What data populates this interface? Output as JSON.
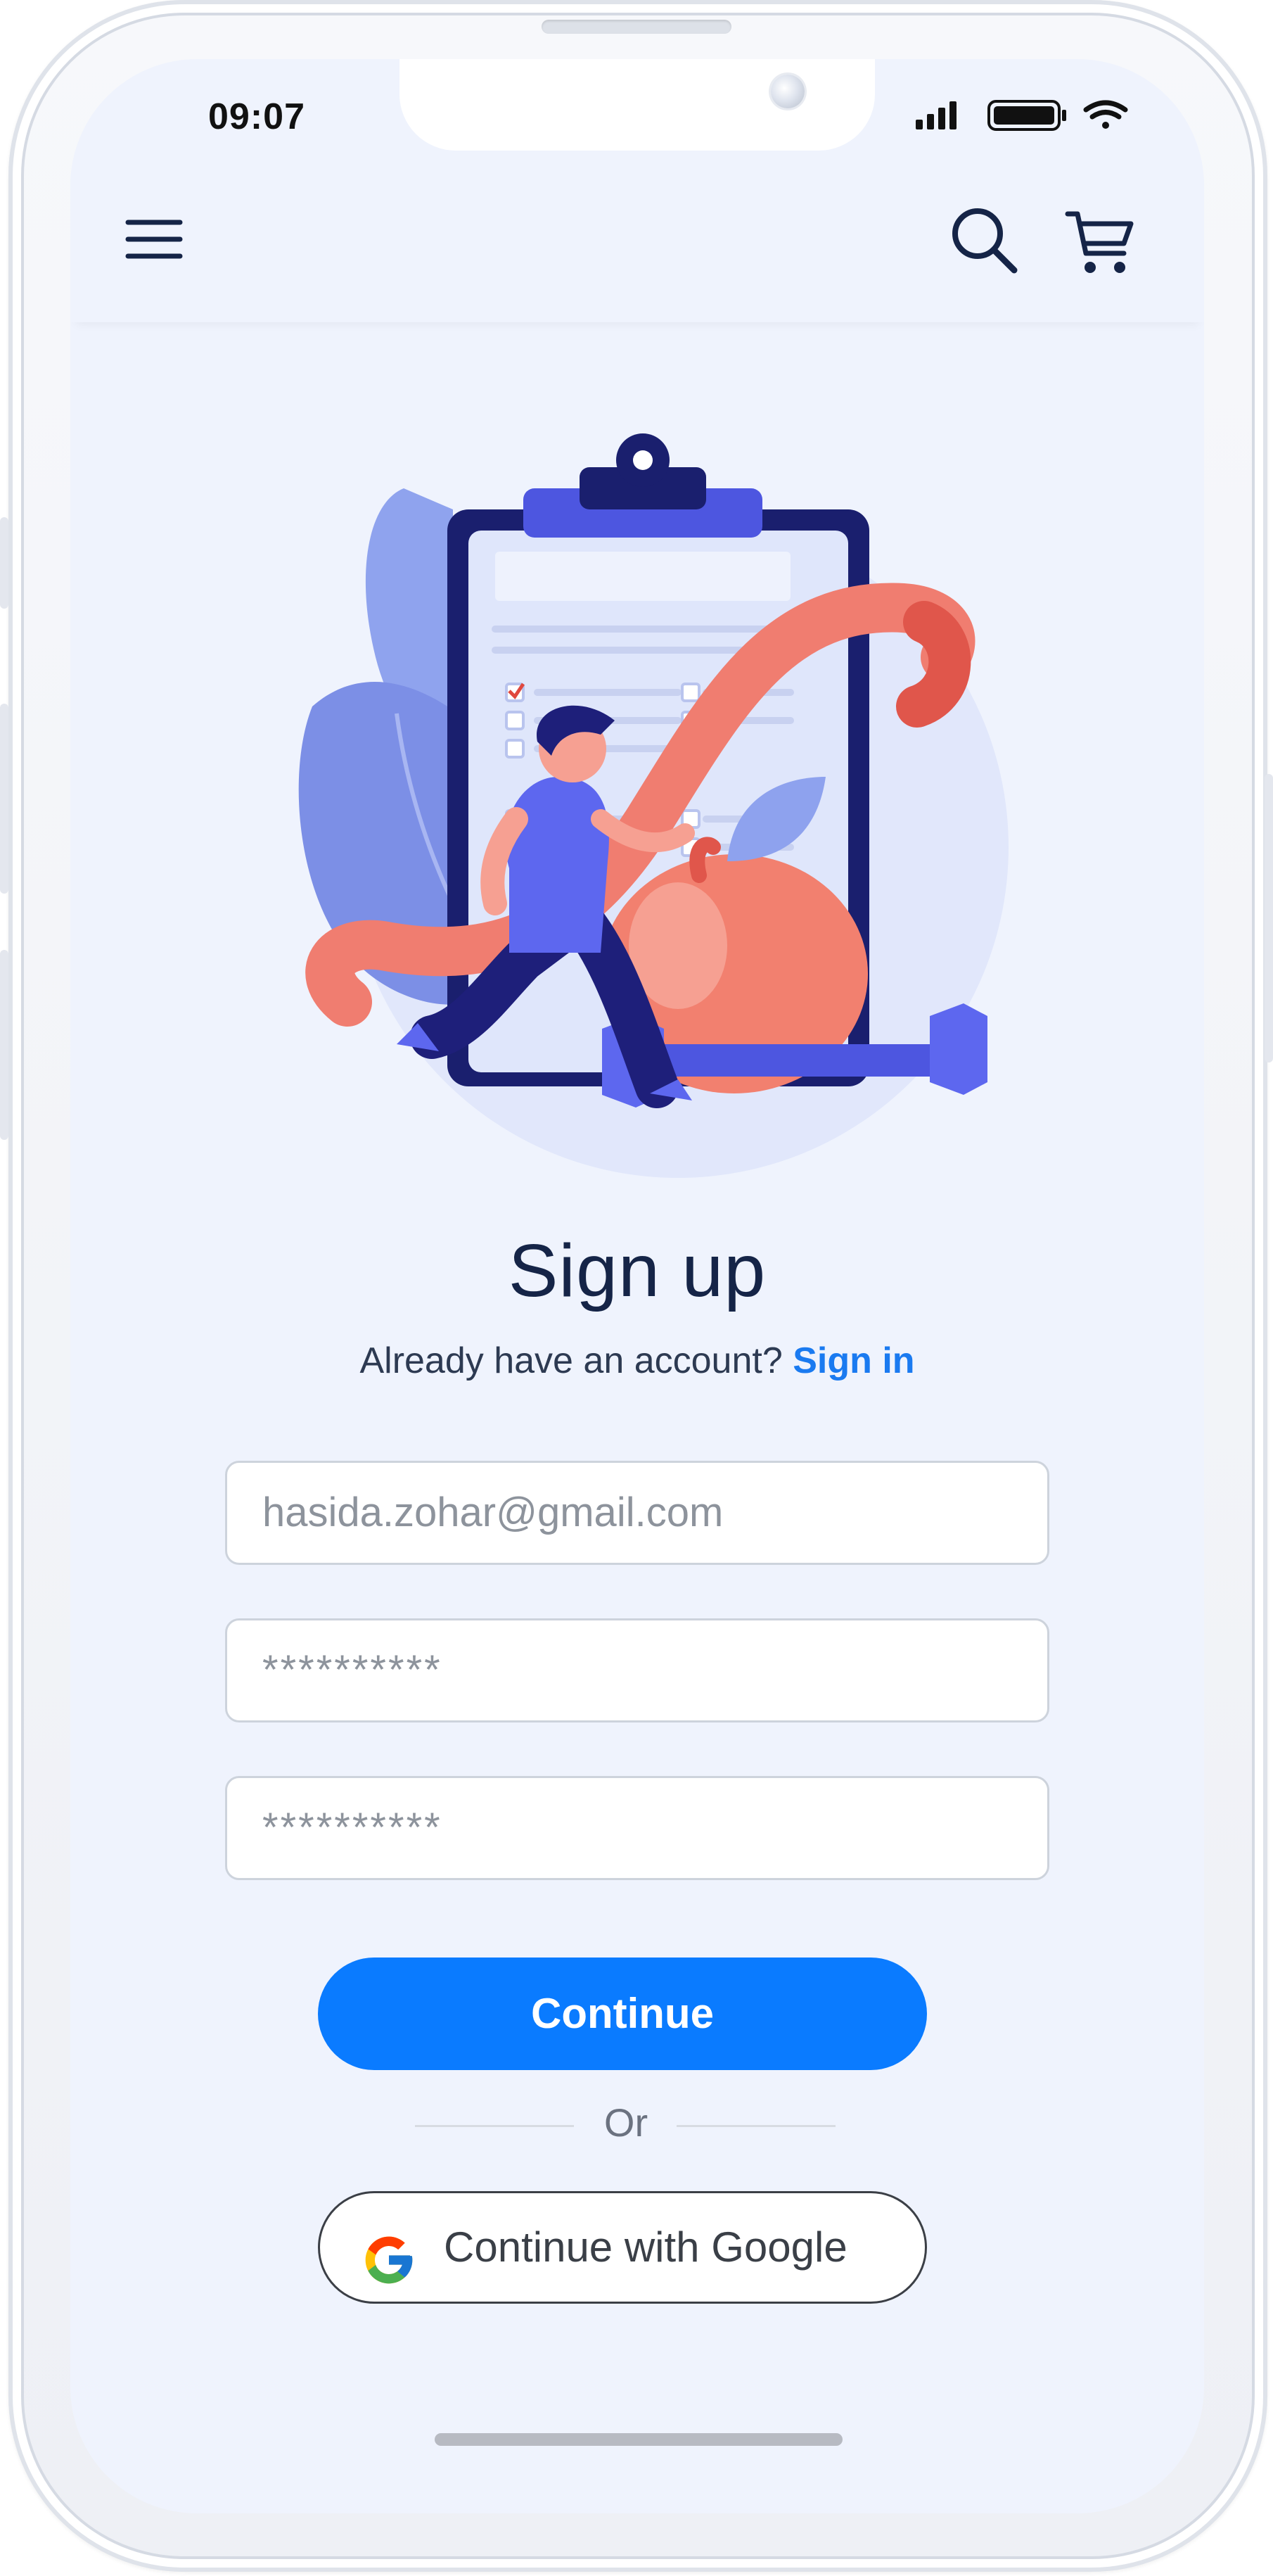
{
  "status_bar": {
    "time": "09:07",
    "icons": [
      "signal-icon",
      "battery-icon",
      "wifi-icon"
    ]
  },
  "header": {
    "icons": [
      "menu-icon",
      "search-icon",
      "cart-icon"
    ]
  },
  "signup": {
    "title": "Sign up",
    "subtitle_prefix": "Already have an account?",
    "signin_link": "Sign in",
    "email_value": "hasida.zohar@gmail.com",
    "password_value": "**********",
    "confirm_password_value": "**********",
    "continue_label": "Continue",
    "or_label": "Or",
    "google_label": "Continue with Google"
  },
  "colors": {
    "screen_background": "#eff3fd",
    "primary_blue": "#0a7bff",
    "link_blue": "#1a7af0",
    "title_navy": "#152447"
  }
}
